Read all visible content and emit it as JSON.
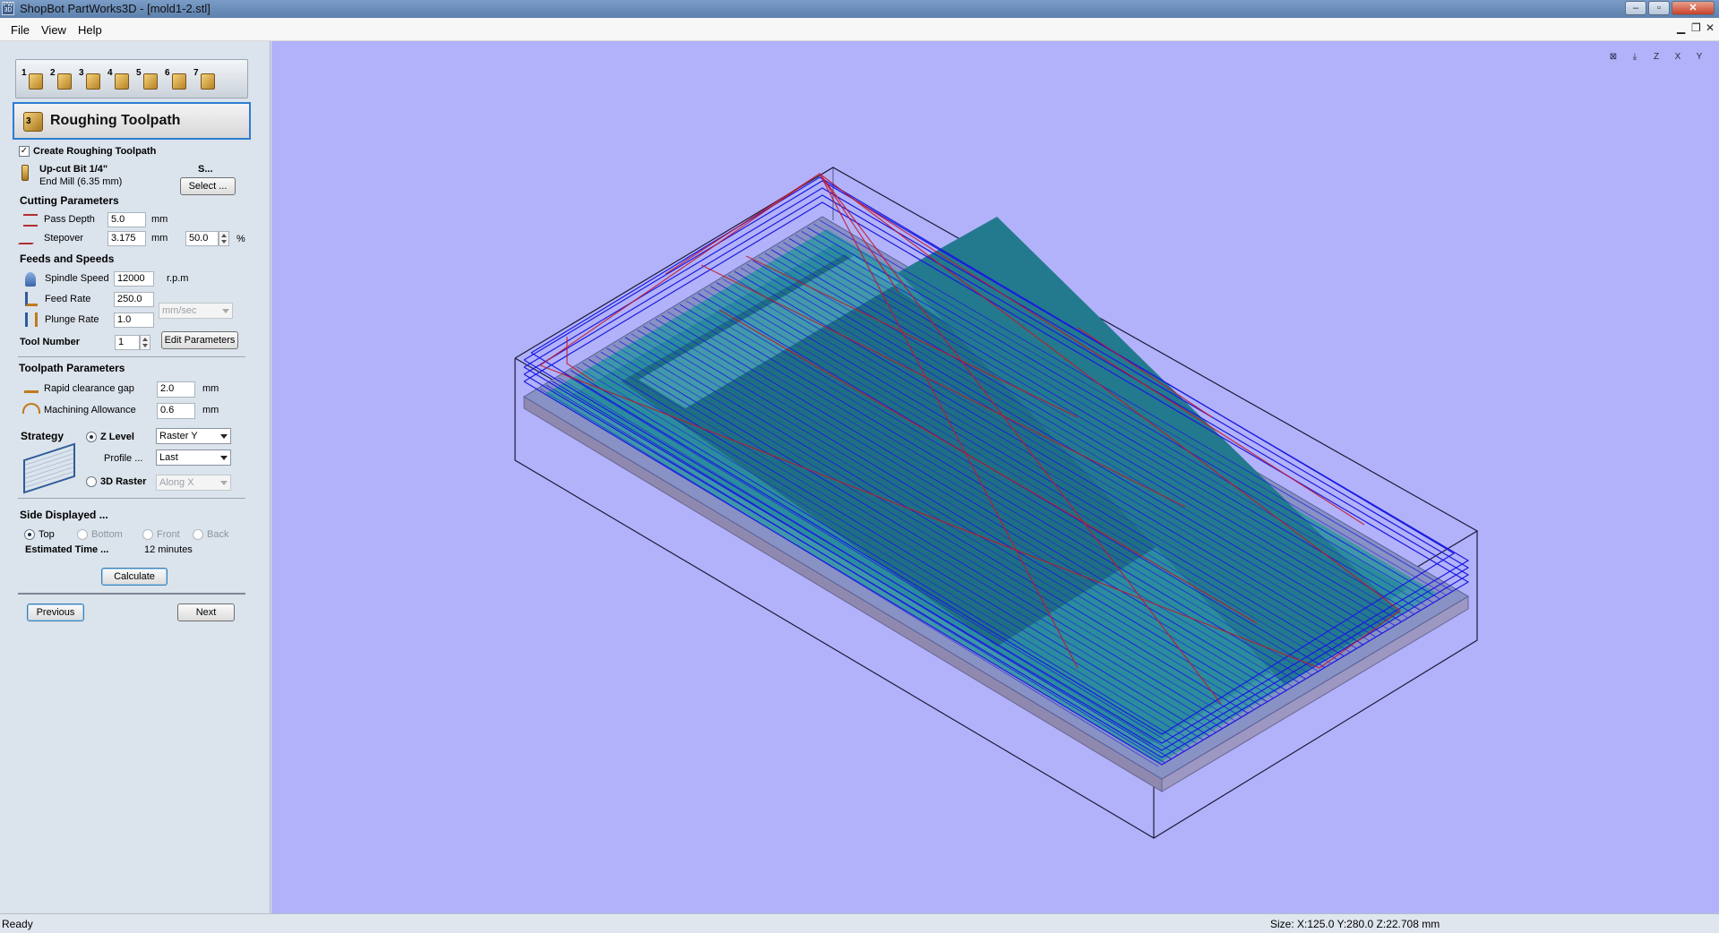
{
  "window": {
    "title": "ShopBot PartWorks3D - [mold1-2.stl]",
    "icon_text": "PW 3D"
  },
  "menu": {
    "items": [
      "File",
      "View",
      "Help"
    ]
  },
  "wizard_steps": [
    "1",
    "2",
    "3",
    "4",
    "5",
    "6",
    "7"
  ],
  "panel": {
    "header": {
      "step": "3",
      "title": "Roughing Toolpath"
    },
    "create_toolpath": {
      "label": "Create Roughing Toolpath",
      "checked": true
    },
    "tool": {
      "name": "Up-cut Bit 1/4\"",
      "description": "End Mill (6.35 mm)",
      "short": "S...",
      "select_label": "Select ..."
    },
    "cutting": {
      "title": "Cutting Parameters",
      "pass_depth_label": "Pass Depth",
      "pass_depth": "5.0",
      "pass_depth_unit": "mm",
      "stepover_label": "Stepover",
      "stepover": "3.175",
      "stepover_unit": "mm",
      "stepover_pct": "50.0",
      "pct_unit": "%"
    },
    "feeds": {
      "title": "Feeds and Speeds",
      "spindle_label": "Spindle Speed",
      "spindle": "12000",
      "spindle_unit": "r.p.m",
      "feed_label": "Feed Rate",
      "feed": "250.0",
      "plunge_label": "Plunge Rate",
      "plunge": "1.0",
      "rate_unit": "mm/sec",
      "tool_number_label": "Tool Number",
      "tool_number": "1",
      "edit_label": "Edit Parameters"
    },
    "toolpath": {
      "title": "Toolpath Parameters",
      "clearance_label": "Rapid clearance gap",
      "clearance": "2.0",
      "clearance_unit": "mm",
      "allowance_label": "Machining Allowance",
      "allowance": "0.6",
      "allowance_unit": "mm"
    },
    "strategy": {
      "title": "Strategy",
      "zlevel_label": "Z Level",
      "zlevel_selected": true,
      "zlevel_option": "Raster Y",
      "profile_label": "Profile ...",
      "profile_option": "Last",
      "raster_label": "3D Raster",
      "raster_option": "Along X"
    },
    "side": {
      "title": "Side Displayed ...",
      "options": [
        "Top",
        "Bottom",
        "Front",
        "Back"
      ],
      "selected": "Top",
      "est_label": "Estimated Time ...",
      "est_value": "12 minutes"
    },
    "calculate_label": "Calculate",
    "previous_label": "Previous",
    "next_label": "Next"
  },
  "view_buttons": [
    "fit-view",
    "iso-view",
    "z-view",
    "x-view",
    "y-view"
  ],
  "view_labels": [
    "",
    "",
    "Z",
    "X",
    "Y"
  ],
  "colors": {
    "viewport_bg": "#b2b2fa",
    "accent": "#2d7dd2",
    "toolpath_blue": "#1a1ae0",
    "rapid_red": "#c4162a",
    "model_teal": "#2f8fa0"
  },
  "status": {
    "left": "Ready",
    "right": "Size: X:125.0 Y:280.0 Z:22.708 mm"
  }
}
